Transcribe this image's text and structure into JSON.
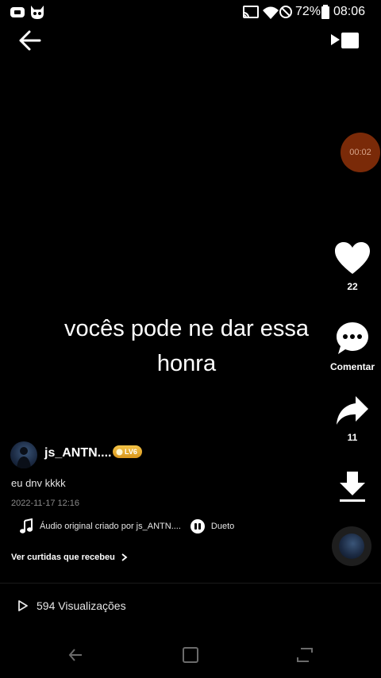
{
  "status_bar": {
    "battery": "72%",
    "time": "08:06",
    "icons": [
      "sim-icon",
      "devil-icon",
      "cast-icon",
      "wifi-icon",
      "do-not-disturb-icon",
      "battery-icon"
    ]
  },
  "top_bar": {
    "back_icon": "arrow-left-icon",
    "video_toggle_icon": "video-camera-icon"
  },
  "video": {
    "caption": "vocês pode ne dar essa honra",
    "timer": "00:02"
  },
  "actions": {
    "like_count": "22",
    "comment_label": "Comentar",
    "share_count": "11"
  },
  "author": {
    "name": "js_ANTN....",
    "level": "LV6"
  },
  "post": {
    "text": "eu dnv kkkk",
    "date": "2022-11-17 12:16"
  },
  "audio": {
    "label": "Áudio original criado por js_ANTN....",
    "duet_label": "Dueto"
  },
  "likes_link": "Ver curtidas que recebeu",
  "views": "594 Visualizações",
  "colors": {
    "background": "#000000",
    "timer_bg": "#7a2a08",
    "level_badge": "#e7ad2e"
  }
}
